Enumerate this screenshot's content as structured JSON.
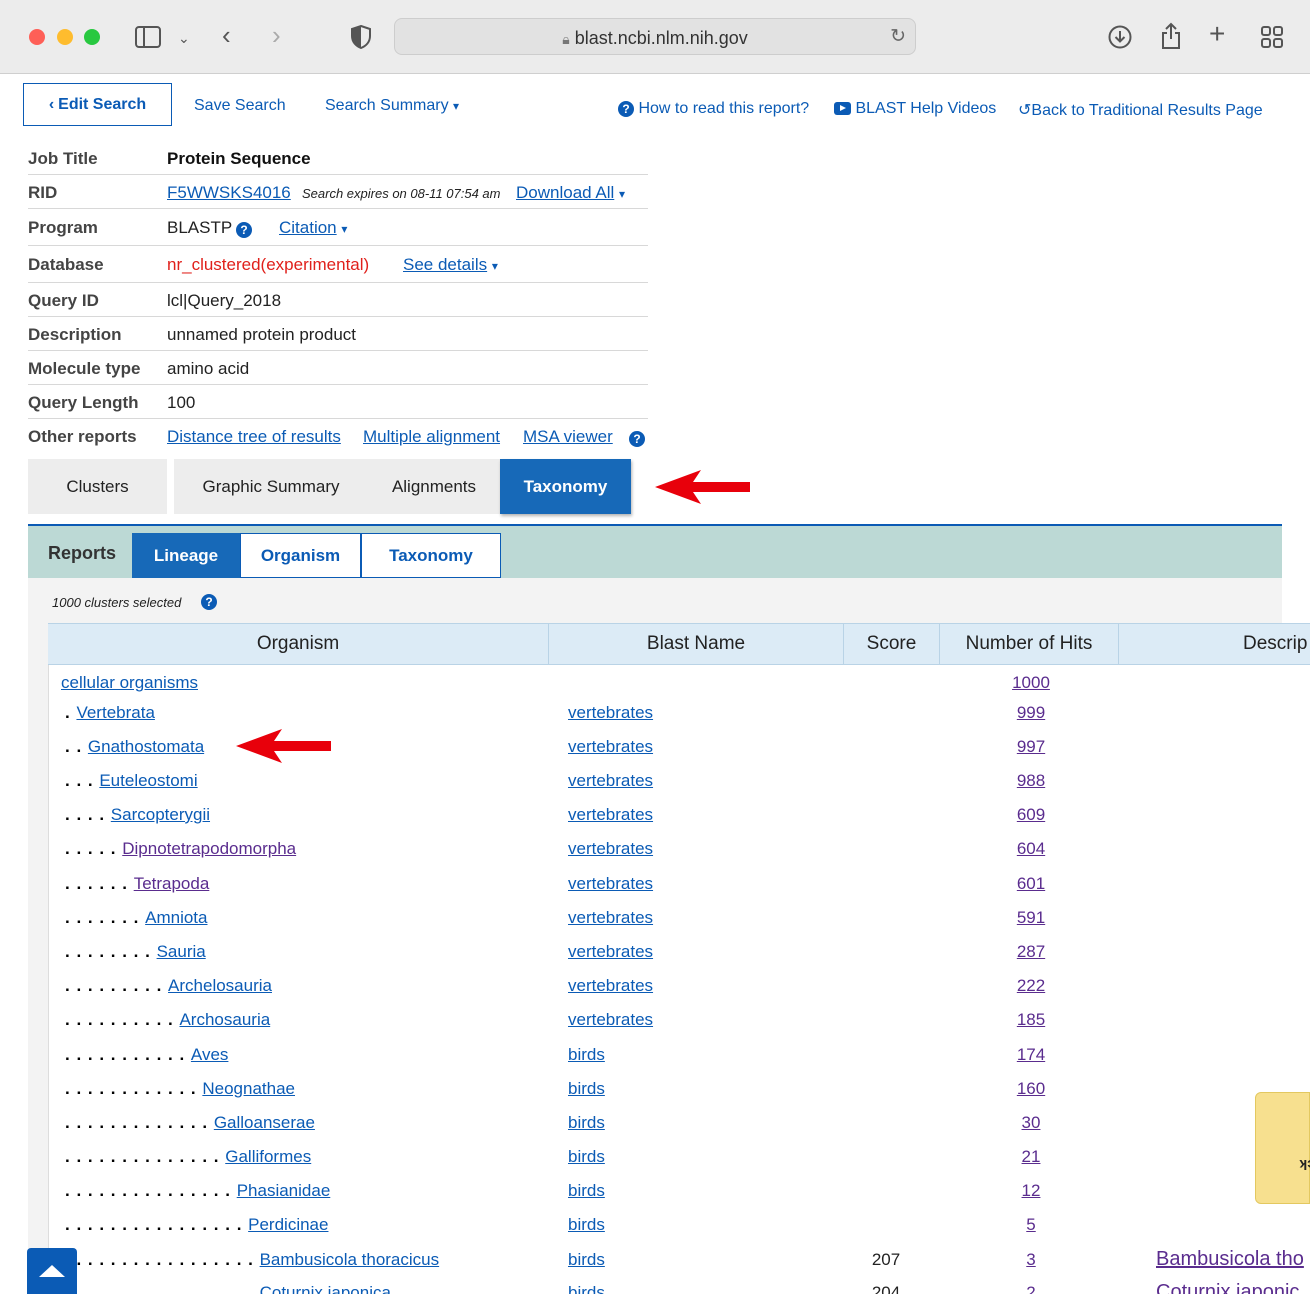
{
  "browser": {
    "url": "blast.ncbi.nlm.nih.gov"
  },
  "toolbar": {
    "edit_search": "Edit Search",
    "save_search": "Save Search",
    "search_summary": "Search Summary",
    "how_to_read": "How to read this report?",
    "help_videos": "BLAST Help Videos",
    "back_traditional": "Back to Traditional Results Page"
  },
  "job": {
    "job_title_label": "Job Title",
    "job_title_value": "Protein Sequence",
    "rid_label": "RID",
    "rid_value": "F5WWSKS4016",
    "rid_expires": "Search expires on 08-11 07:54 am",
    "download_all": "Download All",
    "program_label": "Program",
    "program_value": "BLASTP",
    "citation": "Citation",
    "database_label": "Database",
    "database_value": "nr_clustered(experimental)",
    "see_details": "See details",
    "query_id_label": "Query ID",
    "query_id_value": "lcl|Query_2018",
    "description_label": "Description",
    "description_value": "unnamed protein product",
    "molecule_label": "Molecule type",
    "molecule_value": "amino acid",
    "length_label": "Query Length",
    "length_value": "100",
    "other_label": "Other reports",
    "other_links": [
      "Distance tree of results",
      "Multiple alignment",
      "MSA viewer"
    ]
  },
  "tabs": [
    "Clusters",
    "Graphic Summary",
    "Alignments",
    "Taxonomy"
  ],
  "reports": {
    "label": "Reports",
    "buttons": [
      "Lineage",
      "Organism",
      "Taxonomy"
    ],
    "selected_text": "1000 clusters selected"
  },
  "table": {
    "headers": [
      "Organism",
      "Blast Name",
      "Score",
      "Number of Hits",
      "Descrip"
    ],
    "rows": [
      {
        "depth": 0,
        "organism": "cellular organisms",
        "blast": "",
        "score": "",
        "hits": "1000",
        "desc": ""
      },
      {
        "depth": 1,
        "organism": "Vertebrata",
        "blast": "vertebrates",
        "score": "",
        "hits": "999",
        "desc": ""
      },
      {
        "depth": 2,
        "organism": "Gnathostomata",
        "blast": "vertebrates",
        "score": "",
        "hits": "997",
        "desc": ""
      },
      {
        "depth": 3,
        "organism": "Euteleostomi",
        "blast": "vertebrates",
        "score": "",
        "hits": "988",
        "desc": ""
      },
      {
        "depth": 4,
        "organism": "Sarcopterygii",
        "blast": "vertebrates",
        "score": "",
        "hits": "609",
        "desc": ""
      },
      {
        "depth": 5,
        "organism": "Dipnotetrapodomorpha",
        "blast": "vertebrates",
        "score": "",
        "hits": "604",
        "desc": ""
      },
      {
        "depth": 6,
        "organism": "Tetrapoda",
        "blast": "vertebrates",
        "score": "",
        "hits": "601",
        "desc": ""
      },
      {
        "depth": 7,
        "organism": "Amniota",
        "blast": "vertebrates",
        "score": "",
        "hits": "591",
        "desc": ""
      },
      {
        "depth": 8,
        "organism": "Sauria",
        "blast": "vertebrates",
        "score": "",
        "hits": "287",
        "desc": ""
      },
      {
        "depth": 9,
        "organism": "Archelosauria",
        "blast": "vertebrates",
        "score": "",
        "hits": "222",
        "desc": ""
      },
      {
        "depth": 10,
        "organism": "Archosauria",
        "blast": "vertebrates",
        "score": "",
        "hits": "185",
        "desc": ""
      },
      {
        "depth": 11,
        "organism": "Aves",
        "blast": "birds",
        "score": "",
        "hits": "174",
        "desc": ""
      },
      {
        "depth": 12,
        "organism": "Neognathae",
        "blast": "birds",
        "score": "",
        "hits": "160",
        "desc": ""
      },
      {
        "depth": 13,
        "organism": "Galloanserae",
        "blast": "birds",
        "score": "",
        "hits": "30",
        "desc": ""
      },
      {
        "depth": 14,
        "organism": "Galliformes",
        "blast": "birds",
        "score": "",
        "hits": "21",
        "desc": ""
      },
      {
        "depth": 15,
        "organism": "Phasianidae",
        "blast": "birds",
        "score": "",
        "hits": "12",
        "desc": ""
      },
      {
        "depth": 16,
        "organism": "Perdicinae",
        "blast": "birds",
        "score": "",
        "hits": "5",
        "desc": ""
      },
      {
        "depth": 17,
        "organism": "Bambusicola thoracicus",
        "blast": "birds",
        "score": "207",
        "hits": "3",
        "desc": "Bambusicola tho"
      },
      {
        "depth": 17,
        "organism": "Coturnix japonica",
        "blast": "birds",
        "score": "204",
        "hits": "2",
        "desc": "Coturnix japonic"
      }
    ]
  },
  "feedback": "Feedback",
  "colors": {
    "accent": "#0b5bb5",
    "database_red": "#e0201b",
    "reports_bar": "#bcd9d5",
    "arrow_red": "#e8000b"
  }
}
